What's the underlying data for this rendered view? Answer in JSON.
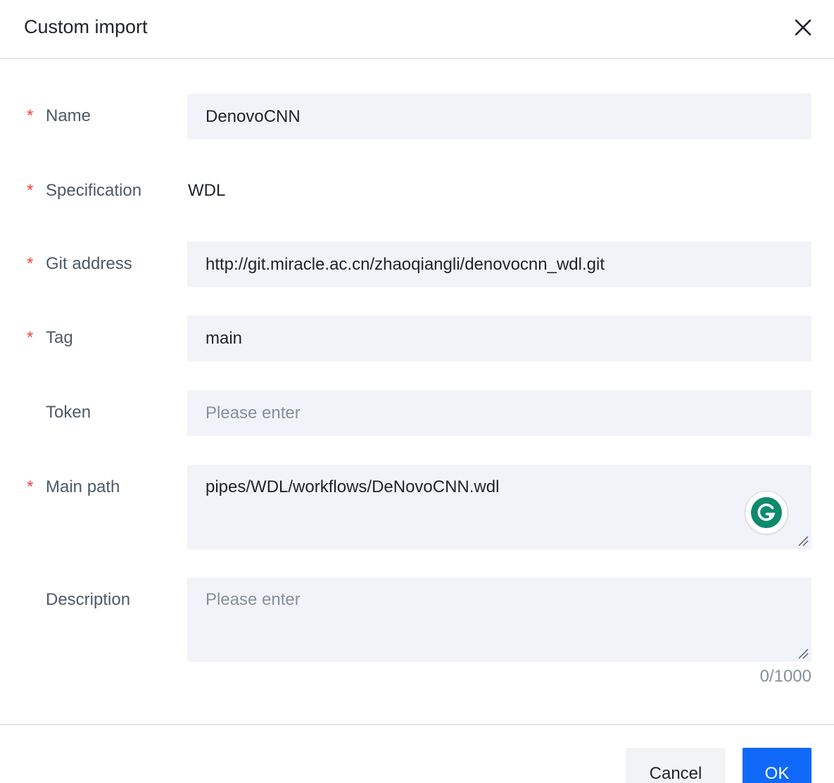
{
  "dialog": {
    "title": "Custom import"
  },
  "form": {
    "name": {
      "label": "Name",
      "required": true,
      "value": "DenovoCNN"
    },
    "specification": {
      "label": "Specification",
      "required": true,
      "value": "WDL"
    },
    "git_address": {
      "label": "Git address",
      "required": true,
      "value": "http://git.miracle.ac.cn/zhaoqiangli/denovocnn_wdl.git"
    },
    "tag": {
      "label": "Tag",
      "required": true,
      "value": "main"
    },
    "token": {
      "label": "Token",
      "required": false,
      "value": "",
      "placeholder": "Please enter"
    },
    "main_path": {
      "label": "Main path",
      "required": true,
      "value": "pipes/WDL/workflows/DeNovoCNN.wdl"
    },
    "description": {
      "label": "Description",
      "required": false,
      "value": "",
      "placeholder": "Please enter",
      "counter": "0/1000"
    }
  },
  "required_mark": "*",
  "footer": {
    "cancel_label": "Cancel",
    "ok_label": "OK"
  },
  "colors": {
    "required": "#f53f3f",
    "primary": "#1169fa",
    "field_bg": "#f2f3f8",
    "grammarly": "#0d8a6e"
  },
  "icons": {
    "close": "close-icon",
    "grammarly": "grammarly-icon",
    "resize": "resize-handle-icon"
  }
}
